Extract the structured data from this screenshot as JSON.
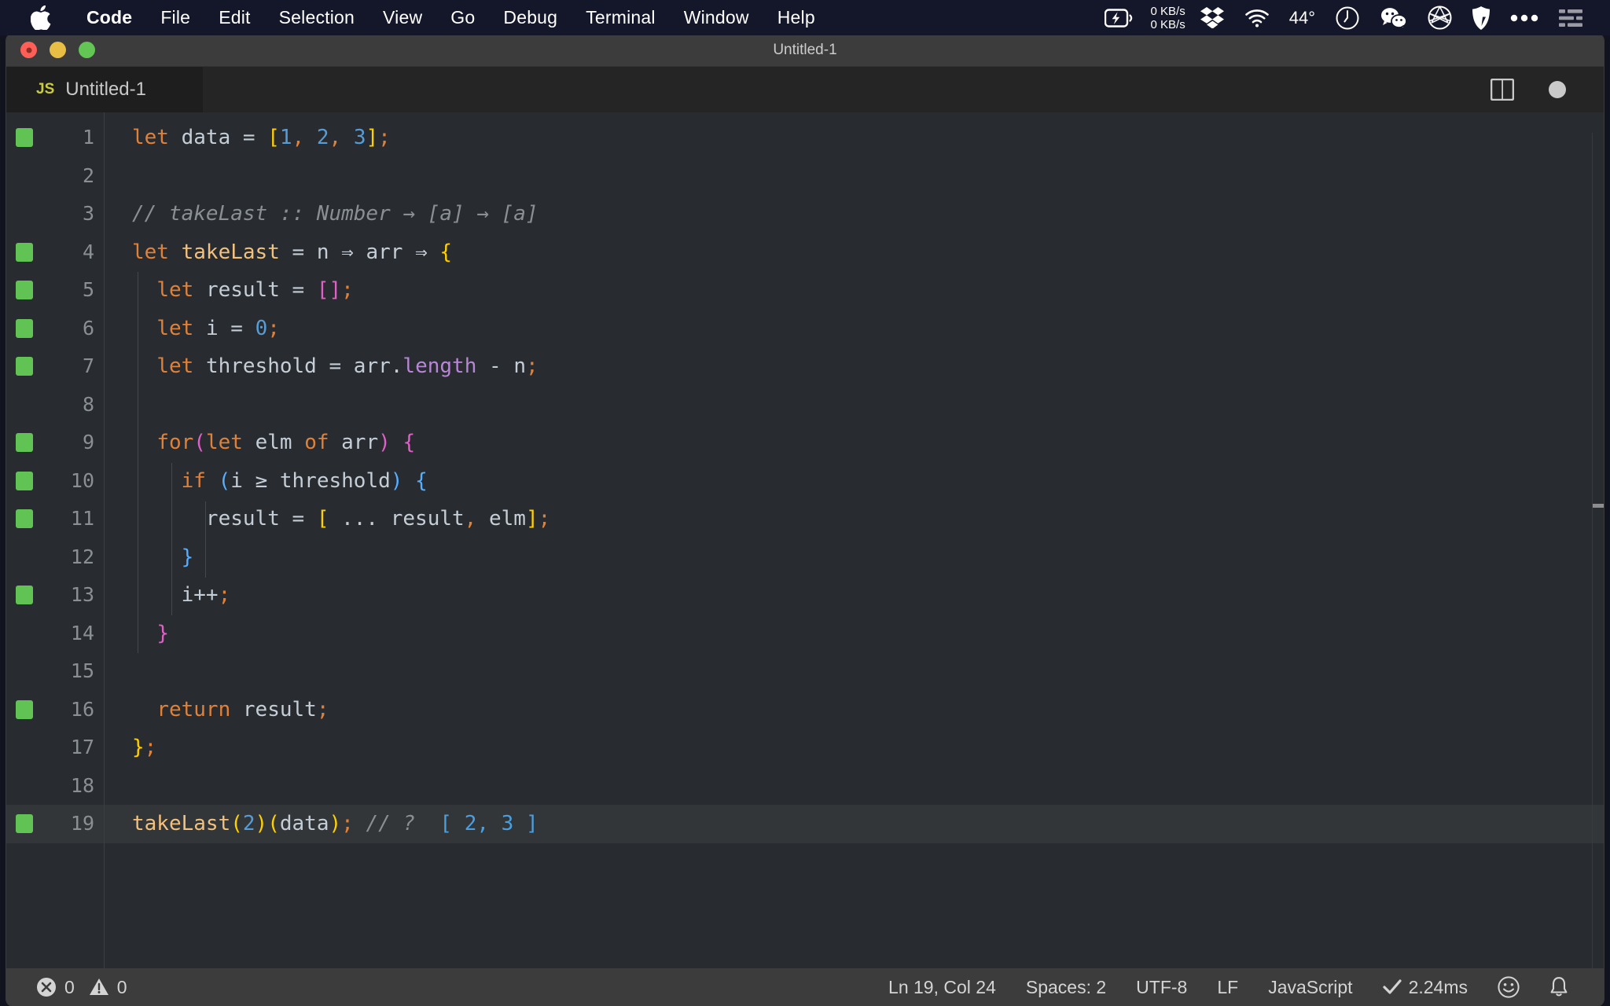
{
  "menubar": {
    "apple_icon": "apple-logo-icon",
    "items": [
      {
        "label": "Code",
        "bold": true
      },
      {
        "label": "File",
        "bold": false
      },
      {
        "label": "Edit",
        "bold": false
      },
      {
        "label": "Selection",
        "bold": false
      },
      {
        "label": "View",
        "bold": false
      },
      {
        "label": "Go",
        "bold": false
      },
      {
        "label": "Debug",
        "bold": false
      },
      {
        "label": "Terminal",
        "bold": false
      },
      {
        "label": "Window",
        "bold": false
      },
      {
        "label": "Help",
        "bold": false
      }
    ],
    "tray": {
      "battery_icon": "battery-charging-icon",
      "network_up": "0 KB/s",
      "network_down": "0 KB/s",
      "dropbox_icon": "dropbox-icon",
      "wifi_icon": "wifi-icon",
      "temperature": "44°",
      "clock_icon": "clock-icon",
      "wechat_icon": "wechat-icon",
      "aperture_icon": "aperture-icon",
      "shield_icon": "shield-icon",
      "more_icon": "ellipsis-icon",
      "list_icon": "control-center-icon"
    }
  },
  "window": {
    "title": "Untitled-1",
    "traffic_lights": [
      "close",
      "minimize",
      "maximize"
    ]
  },
  "tab": {
    "file_badge": "JS",
    "label": "Untitled-1",
    "split_editor_icon": "split-editor-icon",
    "dirty_indicator": "unsaved-dot-icon"
  },
  "editor": {
    "active_line": 19,
    "lines": [
      {
        "n": "1",
        "modified": true,
        "indent": 0
      },
      {
        "n": "2",
        "modified": false,
        "indent": 0
      },
      {
        "n": "3",
        "modified": false,
        "indent": 0
      },
      {
        "n": "4",
        "modified": true,
        "indent": 0
      },
      {
        "n": "5",
        "modified": true,
        "indent": 1
      },
      {
        "n": "6",
        "modified": true,
        "indent": 1
      },
      {
        "n": "7",
        "modified": true,
        "indent": 1
      },
      {
        "n": "8",
        "modified": false,
        "indent": 1
      },
      {
        "n": "9",
        "modified": true,
        "indent": 1
      },
      {
        "n": "10",
        "modified": true,
        "indent": 2
      },
      {
        "n": "11",
        "modified": true,
        "indent": 3
      },
      {
        "n": "12",
        "modified": false,
        "indent": 2
      },
      {
        "n": "13",
        "modified": true,
        "indent": 2
      },
      {
        "n": "14",
        "modified": false,
        "indent": 1
      },
      {
        "n": "15",
        "modified": false,
        "indent": 1
      },
      {
        "n": "16",
        "modified": true,
        "indent": 1
      },
      {
        "n": "17",
        "modified": false,
        "indent": 0
      },
      {
        "n": "18",
        "modified": false,
        "indent": 0
      },
      {
        "n": "19",
        "modified": true,
        "indent": 0
      }
    ],
    "source": [
      "let data = [1, 2, 3];",
      "",
      "// takeLast :: Number → [a] → [a]",
      "let takeLast = n ⇒ arr ⇒ {",
      "  let result = [];",
      "  let i = 0;",
      "  let threshold = arr.length - n;",
      "",
      "  for(let elm of arr) {",
      "    if (i ≥ threshold) {",
      "      result = [ ... result, elm];",
      "    }",
      "    i++;",
      "  }",
      "",
      "  return result;",
      "};",
      "",
      "takeLast(2)(data); // ? [ 2, 3 ]"
    ]
  },
  "statusbar": {
    "error_icon": "error-circle-icon",
    "errors": "0",
    "warning_icon": "warning-triangle-icon",
    "warnings": "0",
    "cursor": "Ln 19, Col 24",
    "indentation": "Spaces: 2",
    "encoding": "UTF-8",
    "eol": "LF",
    "language": "JavaScript",
    "runtime_check_icon": "checkmark-icon",
    "runtime": "2.24ms",
    "feedback_icon": "smiley-icon",
    "bell_icon": "bell-icon"
  },
  "colors": {
    "menubar_bg": "#14162a",
    "titlebar_bg": "#3c3c3c",
    "editor_bg": "#282c30",
    "tab_bg": "#1e1e1e",
    "statusbar_bg": "#3c3c3c",
    "keyword": "#e08139",
    "function": "#f2c17d",
    "number": "#569cd6",
    "property": "#b886d6",
    "comment": "#8a8f93",
    "bracket_yellow": "#ffd000",
    "bracket_pink": "#e060c8",
    "bracket_blue": "#57aeff",
    "git_modified": "#61c354"
  }
}
